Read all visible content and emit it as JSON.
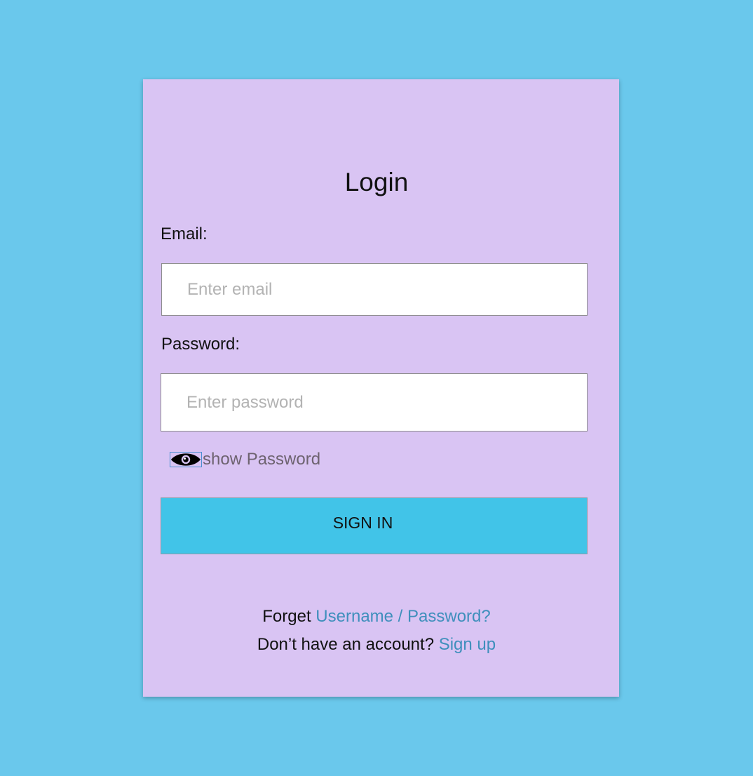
{
  "login": {
    "title": "Login",
    "email_label": "Email:",
    "email_placeholder": "Enter email",
    "email_value": "",
    "password_label": "Password:",
    "password_placeholder": "Enter password",
    "password_value": "",
    "show_password_label": "show Password",
    "show_password_icon": "eye-icon",
    "sign_in_label": "SIGN IN",
    "forgot_prefix": "Forget",
    "forgot_link": "Username / Password?",
    "no_account_prefix": "Don’t have an account?",
    "sign_up_link": "Sign up"
  },
  "colors": {
    "page_background": "#6ac8ec",
    "card_background": "#d9c4f3",
    "button_background": "#41c4e8",
    "link_color": "#3f8fbc"
  }
}
